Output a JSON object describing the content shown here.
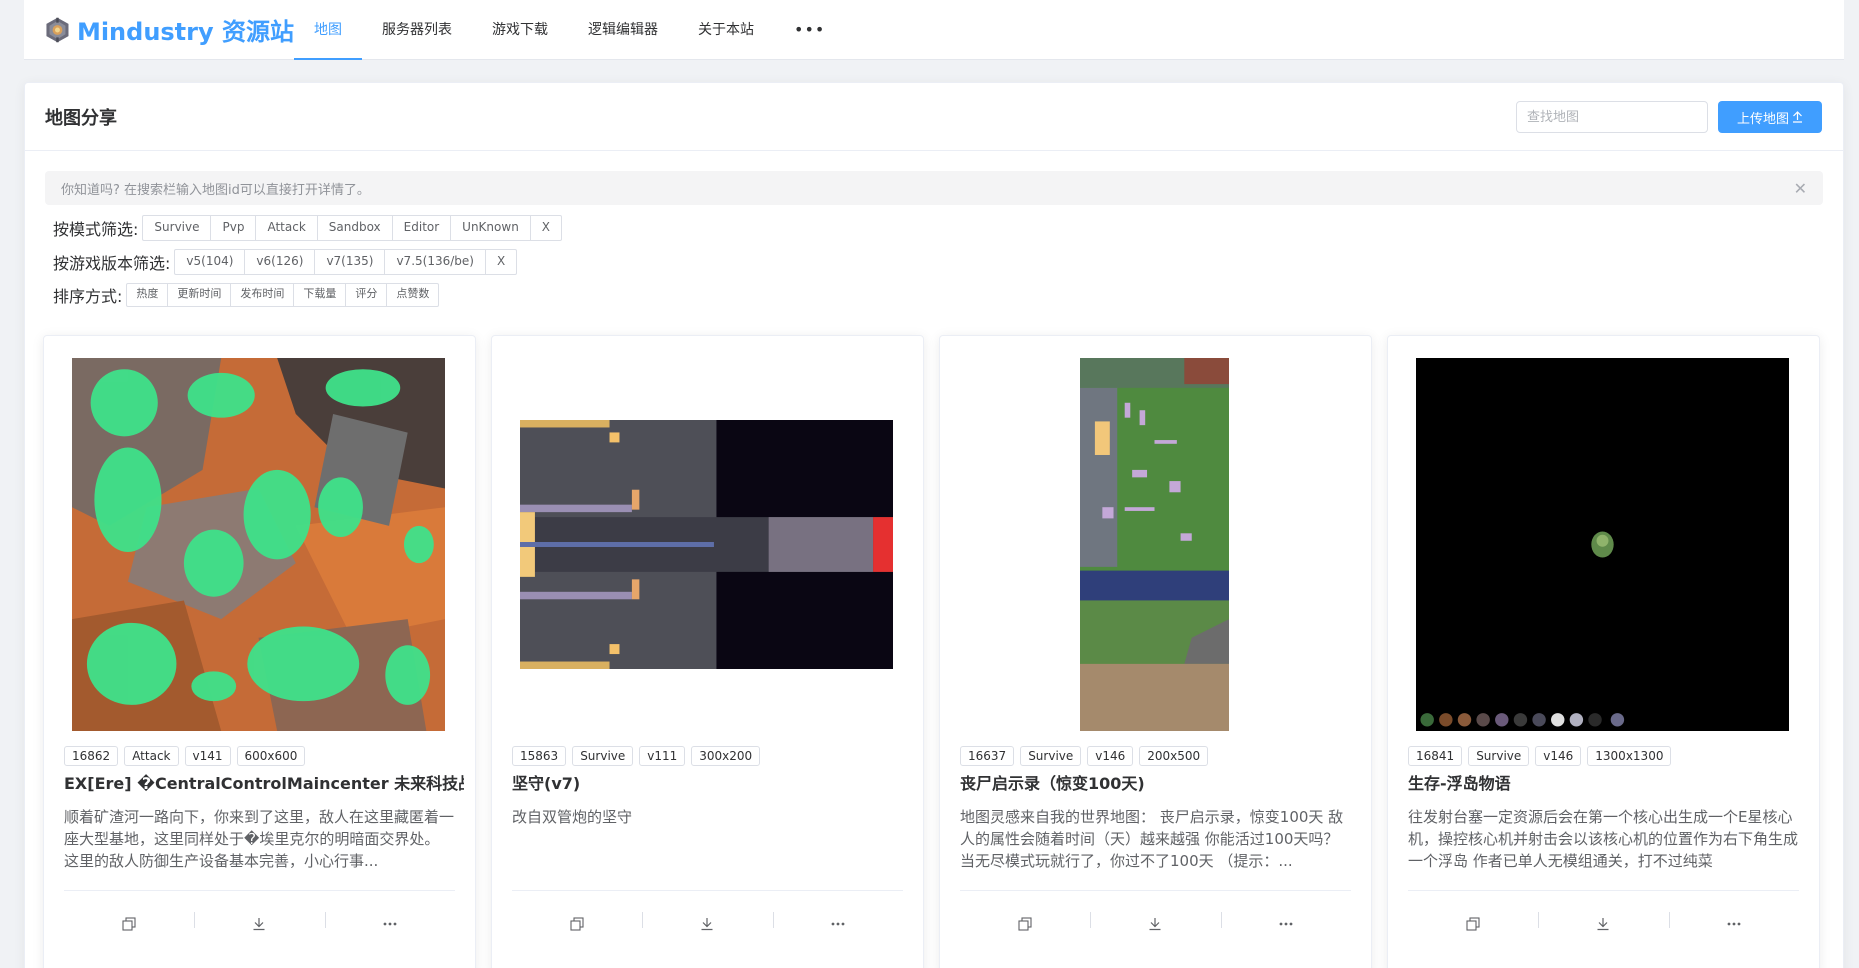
{
  "site": {
    "logo_text": "Mindustry 资源站",
    "nav": [
      {
        "label": "地图",
        "active": true
      },
      {
        "label": "服务器列表",
        "active": false
      },
      {
        "label": "游戏下载",
        "active": false
      },
      {
        "label": "逻辑编辑器",
        "active": false
      },
      {
        "label": "关于本站",
        "active": false
      }
    ],
    "nav_more": "•••"
  },
  "header": {
    "title": "地图分享",
    "search_placeholder": "查找地图",
    "upload_label": "上传地图"
  },
  "tip": {
    "text": "你知道吗? 在搜索栏输入地图id可以直接打开详情了。",
    "close": "✕"
  },
  "filters": {
    "mode": {
      "label": "按模式筛选:",
      "options": [
        "Survive",
        "Pvp",
        "Attack",
        "Sandbox",
        "Editor",
        "UnKnown",
        "X"
      ]
    },
    "version": {
      "label": "按游戏版本筛选:",
      "options": [
        "v5(104)",
        "v6(126)",
        "v7(135)",
        "v7.5(136/be)",
        "X"
      ]
    },
    "sort": {
      "label": "排序方式:",
      "options": [
        "热度",
        "更新时间",
        "发布时间",
        "下载量",
        "评分",
        "点赞数"
      ]
    }
  },
  "maps": [
    {
      "id": "16862",
      "mode": "Attack",
      "version": "v141",
      "size": "600x600",
      "title": "EX[Ere] �CentralControlMaincenter 未来科技战役",
      "desc": "顺着矿渣河一路向下，你来到了这里，敌人在这里藏匿着一座大型基地，这里同样处于�埃里克尔的明暗面交界处。 这里的敌人防御生产设备基本完善，小心行事..."
    },
    {
      "id": "15863",
      "mode": "Survive",
      "version": "v111",
      "size": "300x200",
      "title": "坚守(v7)",
      "desc": "改自双管炮的坚守"
    },
    {
      "id": "16637",
      "mode": "Survive",
      "version": "v146",
      "size": "200x500",
      "title": "丧尸启示录（惊变100天)",
      "desc": "地图灵感来自我的世界地图： 丧尸启示录，惊变100天 敌人的属性会随着时间（天）越来越强 你能活过100天吗？ 当无尽模式玩就行了，你过不了100天 （提示：..."
    },
    {
      "id": "16841",
      "mode": "Survive",
      "version": "v146",
      "size": "1300x1300",
      "title": "生存-浮岛物语",
      "desc": "往发射台塞一定资源后会在第一个核心出生成一个E星核心机，操控核心机并射击会以该核心机的位置作为右下角生成一个浮岛 作者已单人无模组通关，打不过纯菜"
    }
  ],
  "colors": {
    "accent": "#409eff",
    "border": "#dcdfe6",
    "text": "#303133"
  }
}
